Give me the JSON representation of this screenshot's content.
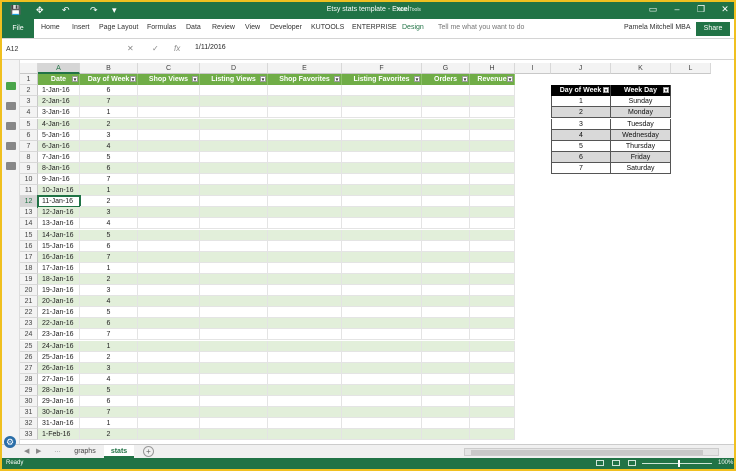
{
  "window": {
    "title": "Etsy stats template - Excel",
    "context_tab": "Table Tools",
    "user": "Pamela Mitchell MBA",
    "share_label": "Share",
    "minimize_glyph": "–",
    "restore_glyph": "❐",
    "close_glyph": "✕",
    "ribbon_options_glyph": "▭"
  },
  "quick_access": {
    "save_icon": "💾",
    "touch_icon": "✥",
    "undo_icon": "↶",
    "redo_icon": "↷",
    "customize_icon": "▾"
  },
  "ribbon": {
    "file_label": "File",
    "tabs": [
      "Home",
      "Insert",
      "Page Layout",
      "Formulas",
      "Data",
      "Review",
      "View",
      "Developer",
      "KUTOOLS",
      "ENTERPRISE",
      "Design"
    ],
    "tell_me": "Tell me what you want to do"
  },
  "formula_bar": {
    "name_box": "A12",
    "cancel_glyph": "✕",
    "enter_glyph": "✓",
    "fx_label": "fx",
    "value": "1/11/2016"
  },
  "columns": [
    "A",
    "B",
    "C",
    "D",
    "E",
    "F",
    "G",
    "H",
    "I",
    "J",
    "K",
    "L"
  ],
  "selected_cell": {
    "column": "A",
    "row": 12
  },
  "table": {
    "headers": [
      "Date",
      "Day of Week",
      "Shop Views",
      "Listing Views",
      "Shop Favorites",
      "Listing Favorites",
      "Orders",
      "Revenue"
    ],
    "rows": [
      {
        "date": "1-Jan-16",
        "dow": "6"
      },
      {
        "date": "2-Jan-16",
        "dow": "7"
      },
      {
        "date": "3-Jan-16",
        "dow": "1"
      },
      {
        "date": "4-Jan-16",
        "dow": "2"
      },
      {
        "date": "5-Jan-16",
        "dow": "3"
      },
      {
        "date": "6-Jan-16",
        "dow": "4"
      },
      {
        "date": "7-Jan-16",
        "dow": "5"
      },
      {
        "date": "8-Jan-16",
        "dow": "6"
      },
      {
        "date": "9-Jan-16",
        "dow": "7"
      },
      {
        "date": "10-Jan-16",
        "dow": "1"
      },
      {
        "date": "11-Jan-16",
        "dow": "2"
      },
      {
        "date": "12-Jan-16",
        "dow": "3"
      },
      {
        "date": "13-Jan-16",
        "dow": "4"
      },
      {
        "date": "14-Jan-16",
        "dow": "5"
      },
      {
        "date": "15-Jan-16",
        "dow": "6"
      },
      {
        "date": "16-Jan-16",
        "dow": "7"
      },
      {
        "date": "17-Jan-16",
        "dow": "1"
      },
      {
        "date": "18-Jan-16",
        "dow": "2"
      },
      {
        "date": "19-Jan-16",
        "dow": "3"
      },
      {
        "date": "20-Jan-16",
        "dow": "4"
      },
      {
        "date": "21-Jan-16",
        "dow": "5"
      },
      {
        "date": "22-Jan-16",
        "dow": "6"
      },
      {
        "date": "23-Jan-16",
        "dow": "7"
      },
      {
        "date": "24-Jan-16",
        "dow": "1"
      },
      {
        "date": "25-Jan-16",
        "dow": "2"
      },
      {
        "date": "26-Jan-16",
        "dow": "3"
      },
      {
        "date": "27-Jan-16",
        "dow": "4"
      },
      {
        "date": "28-Jan-16",
        "dow": "5"
      },
      {
        "date": "29-Jan-16",
        "dow": "6"
      },
      {
        "date": "30-Jan-16",
        "dow": "7"
      },
      {
        "date": "31-Jan-16",
        "dow": "1"
      },
      {
        "date": "1-Feb-16",
        "dow": "2"
      }
    ]
  },
  "lookup": {
    "headers": [
      "Day of Week",
      "Week Day"
    ],
    "rows": [
      [
        "1",
        "Sunday"
      ],
      [
        "2",
        "Monday"
      ],
      [
        "3",
        "Tuesday"
      ],
      [
        "4",
        "Wednesday"
      ],
      [
        "5",
        "Thursday"
      ],
      [
        "6",
        "Friday"
      ],
      [
        "7",
        "Saturday"
      ]
    ]
  },
  "sheets": {
    "tabs": [
      "graphs",
      "stats"
    ],
    "active": "stats",
    "add_glyph": "+",
    "more_glyph": "…"
  },
  "status": {
    "ready": "Ready",
    "zoom": "100%"
  },
  "colors": {
    "accent": "#217346",
    "table_header": "#70ad47",
    "band": "#e2efda",
    "lookup_header": "#000000",
    "lookup_band": "#d9d9d9"
  }
}
